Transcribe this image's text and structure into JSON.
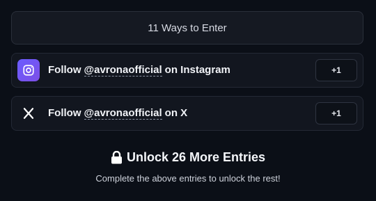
{
  "header": {
    "ways_label": "11 Ways to Enter"
  },
  "entries": [
    {
      "icon": "instagram-icon",
      "prefix": "Follow",
      "handle": "@avronaofficial",
      "suffix": "on Instagram",
      "points": "+1",
      "accent": "#6a5cff"
    },
    {
      "icon": "x-icon",
      "prefix": "Follow",
      "handle": "@avronaofficial",
      "suffix": "on X",
      "points": "+1"
    }
  ],
  "unlock": {
    "icon": "lock-icon",
    "title": "Unlock 26 More Entries",
    "subtitle": "Complete the above entries to unlock the rest!"
  },
  "colors": {
    "background": "#0b0f17",
    "card": "#12161f",
    "border": "#242935"
  }
}
